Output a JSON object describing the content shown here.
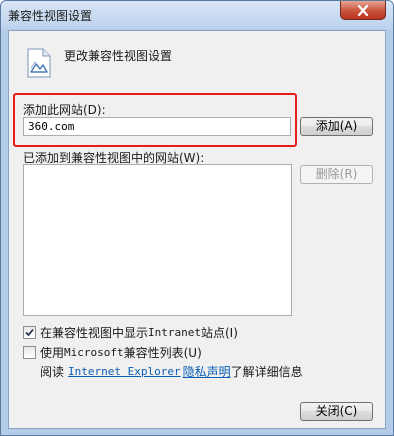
{
  "window": {
    "title": "兼容性视图设置"
  },
  "header": {
    "text": "更改兼容性视图设置"
  },
  "add_site": {
    "label": "添加此网站(D):",
    "value": "360.com",
    "button": "添加(A)"
  },
  "site_list": {
    "label": "已添加到兼容性视图中的网站(W):",
    "items": [],
    "remove_button": "删除(R)"
  },
  "options": {
    "intranet": {
      "label_prefix": "在兼容性视图中显示 ",
      "label_mono": "Intranet",
      "label_suffix": " 站点(I)",
      "checked": true
    },
    "ms_list": {
      "label_prefix": "使用 ",
      "label_mono": "Microsoft",
      "label_suffix": " 兼容性列表(U)",
      "checked": false
    }
  },
  "info": {
    "prefix": "阅读",
    "link_mono": "Internet Explorer",
    "link_text": "隐私声明",
    "suffix": "了解详细信息"
  },
  "footer": {
    "close_button": "关闭(C)"
  },
  "colors": {
    "highlight": "#e81c1c",
    "link": "#0a5fb5"
  }
}
